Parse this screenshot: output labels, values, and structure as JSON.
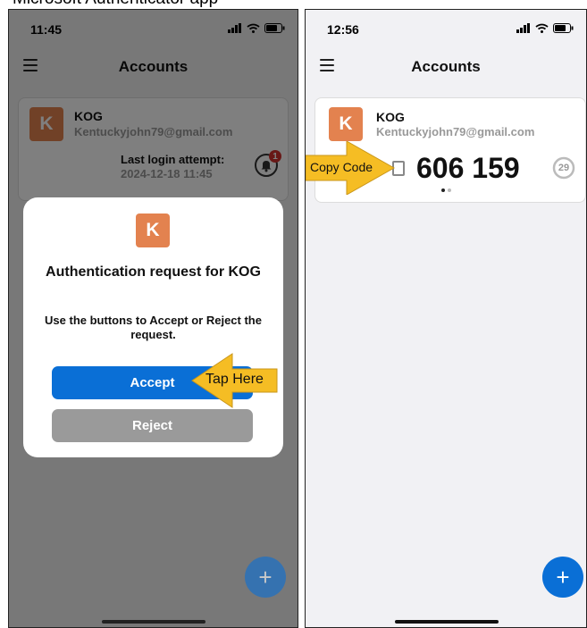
{
  "page_header": {
    "text": "Microsoft Authenticator app"
  },
  "left_phone": {
    "status": {
      "time": "11:45"
    },
    "app_title": "Accounts",
    "account": {
      "avatar_letter": "K",
      "name": "KOG",
      "email": "Kentuckyjohn79@gmail.com",
      "last_login_label": "Last login attempt:",
      "last_login_value": "2024-12-18 11:45",
      "notification_count": "1"
    },
    "dialog": {
      "avatar_letter": "K",
      "title": "Authentication request for KOG",
      "message": "Use the buttons to Accept or Reject the request.",
      "accept_label": "Accept",
      "reject_label": "Reject"
    },
    "fab_label": "+",
    "callout_label": "Tap Here"
  },
  "right_phone": {
    "status": {
      "time": "12:56"
    },
    "app_title": "Accounts",
    "account": {
      "avatar_letter": "K",
      "name": "KOG",
      "email": "Kentuckyjohn79@gmail.com",
      "code": "606 159",
      "seconds_left": "29"
    },
    "fab_label": "+",
    "callout_label": "Copy Code"
  },
  "colors": {
    "primary_blue": "#0a6fd6",
    "avatar_orange": "#e3824f",
    "reject_gray": "#9a9a9a",
    "callout_yellow": "#f5bd24",
    "badge_red": "#d0312d"
  }
}
